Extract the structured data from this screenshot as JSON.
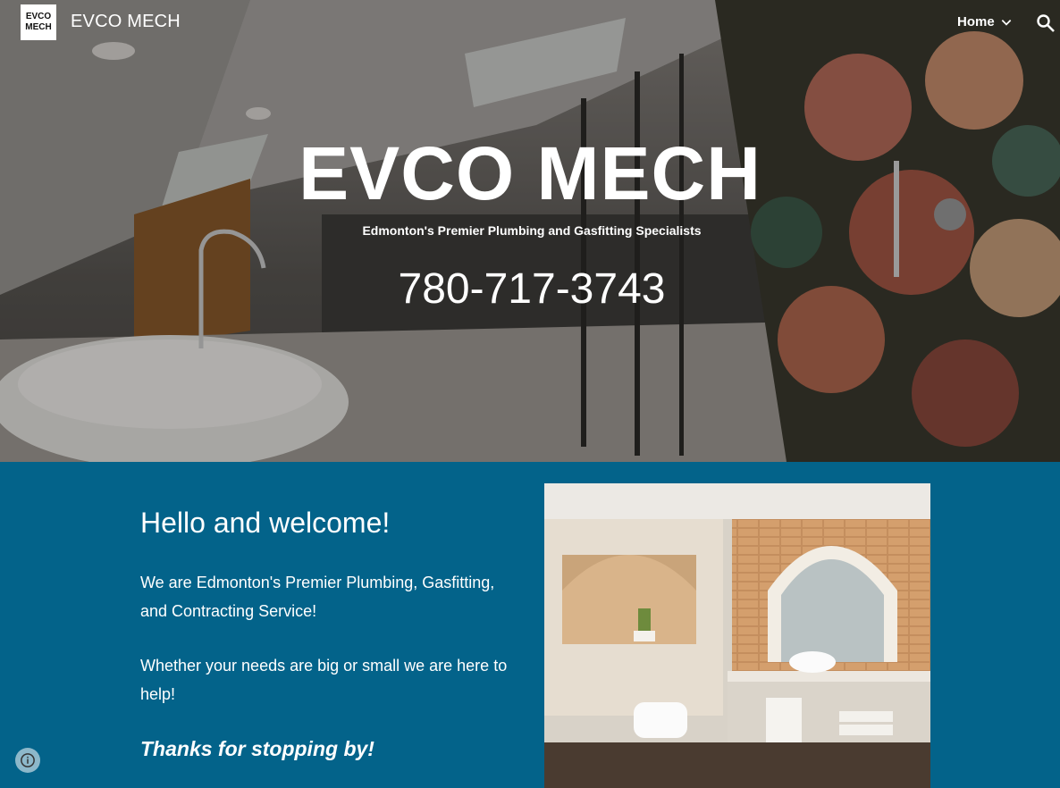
{
  "header": {
    "logo_line1": "EVCO",
    "logo_line2": "MECH",
    "site_title": "EVCO MECH",
    "nav_home_label": "Home",
    "icons": [
      "chevron-down-icon",
      "search-icon"
    ]
  },
  "hero": {
    "title": "EVCO MECH",
    "subtitle": "Edmonton's Premier Plumbing and Gasfitting Specialists",
    "phone": "780-717-3743"
  },
  "main": {
    "heading": "Hello and welcome!",
    "paragraph1": "We are Edmonton's Premier Plumbing, Gasfitting, and Contracting Service!",
    "paragraph2": "Whether your needs are big or small we are here to help!",
    "thanks": "Thanks for stopping by!"
  },
  "colors": {
    "section_bg": "#03638a",
    "text": "#ffffff"
  },
  "footer": {
    "info_icon": "info-icon"
  }
}
